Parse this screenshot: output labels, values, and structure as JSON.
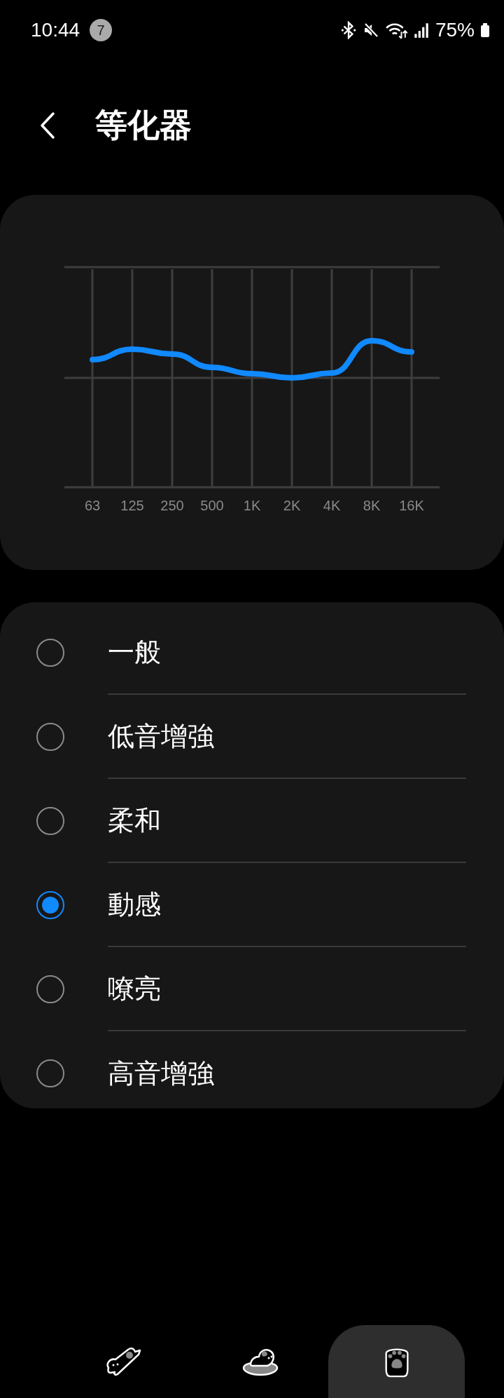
{
  "status_bar": {
    "time": "10:44",
    "notification_count": "7",
    "battery": "75%"
  },
  "header": {
    "title": "等化器"
  },
  "equalizer": {
    "bands": [
      "63",
      "125",
      "250",
      "500",
      "1K",
      "2K",
      "4K",
      "8K",
      "16K"
    ]
  },
  "presets": [
    {
      "label": "一般",
      "selected": false
    },
    {
      "label": "低音增強",
      "selected": false
    },
    {
      "label": "柔和",
      "selected": false
    },
    {
      "label": "動感",
      "selected": true
    },
    {
      "label": "嘹亮",
      "selected": false
    },
    {
      "label": "高音增強",
      "selected": false
    }
  ],
  "nav_bar": [
    {
      "kind": "dog-run",
      "selected": false
    },
    {
      "kind": "dog-bed",
      "selected": false
    },
    {
      "kind": "paw",
      "selected": true
    }
  ]
}
